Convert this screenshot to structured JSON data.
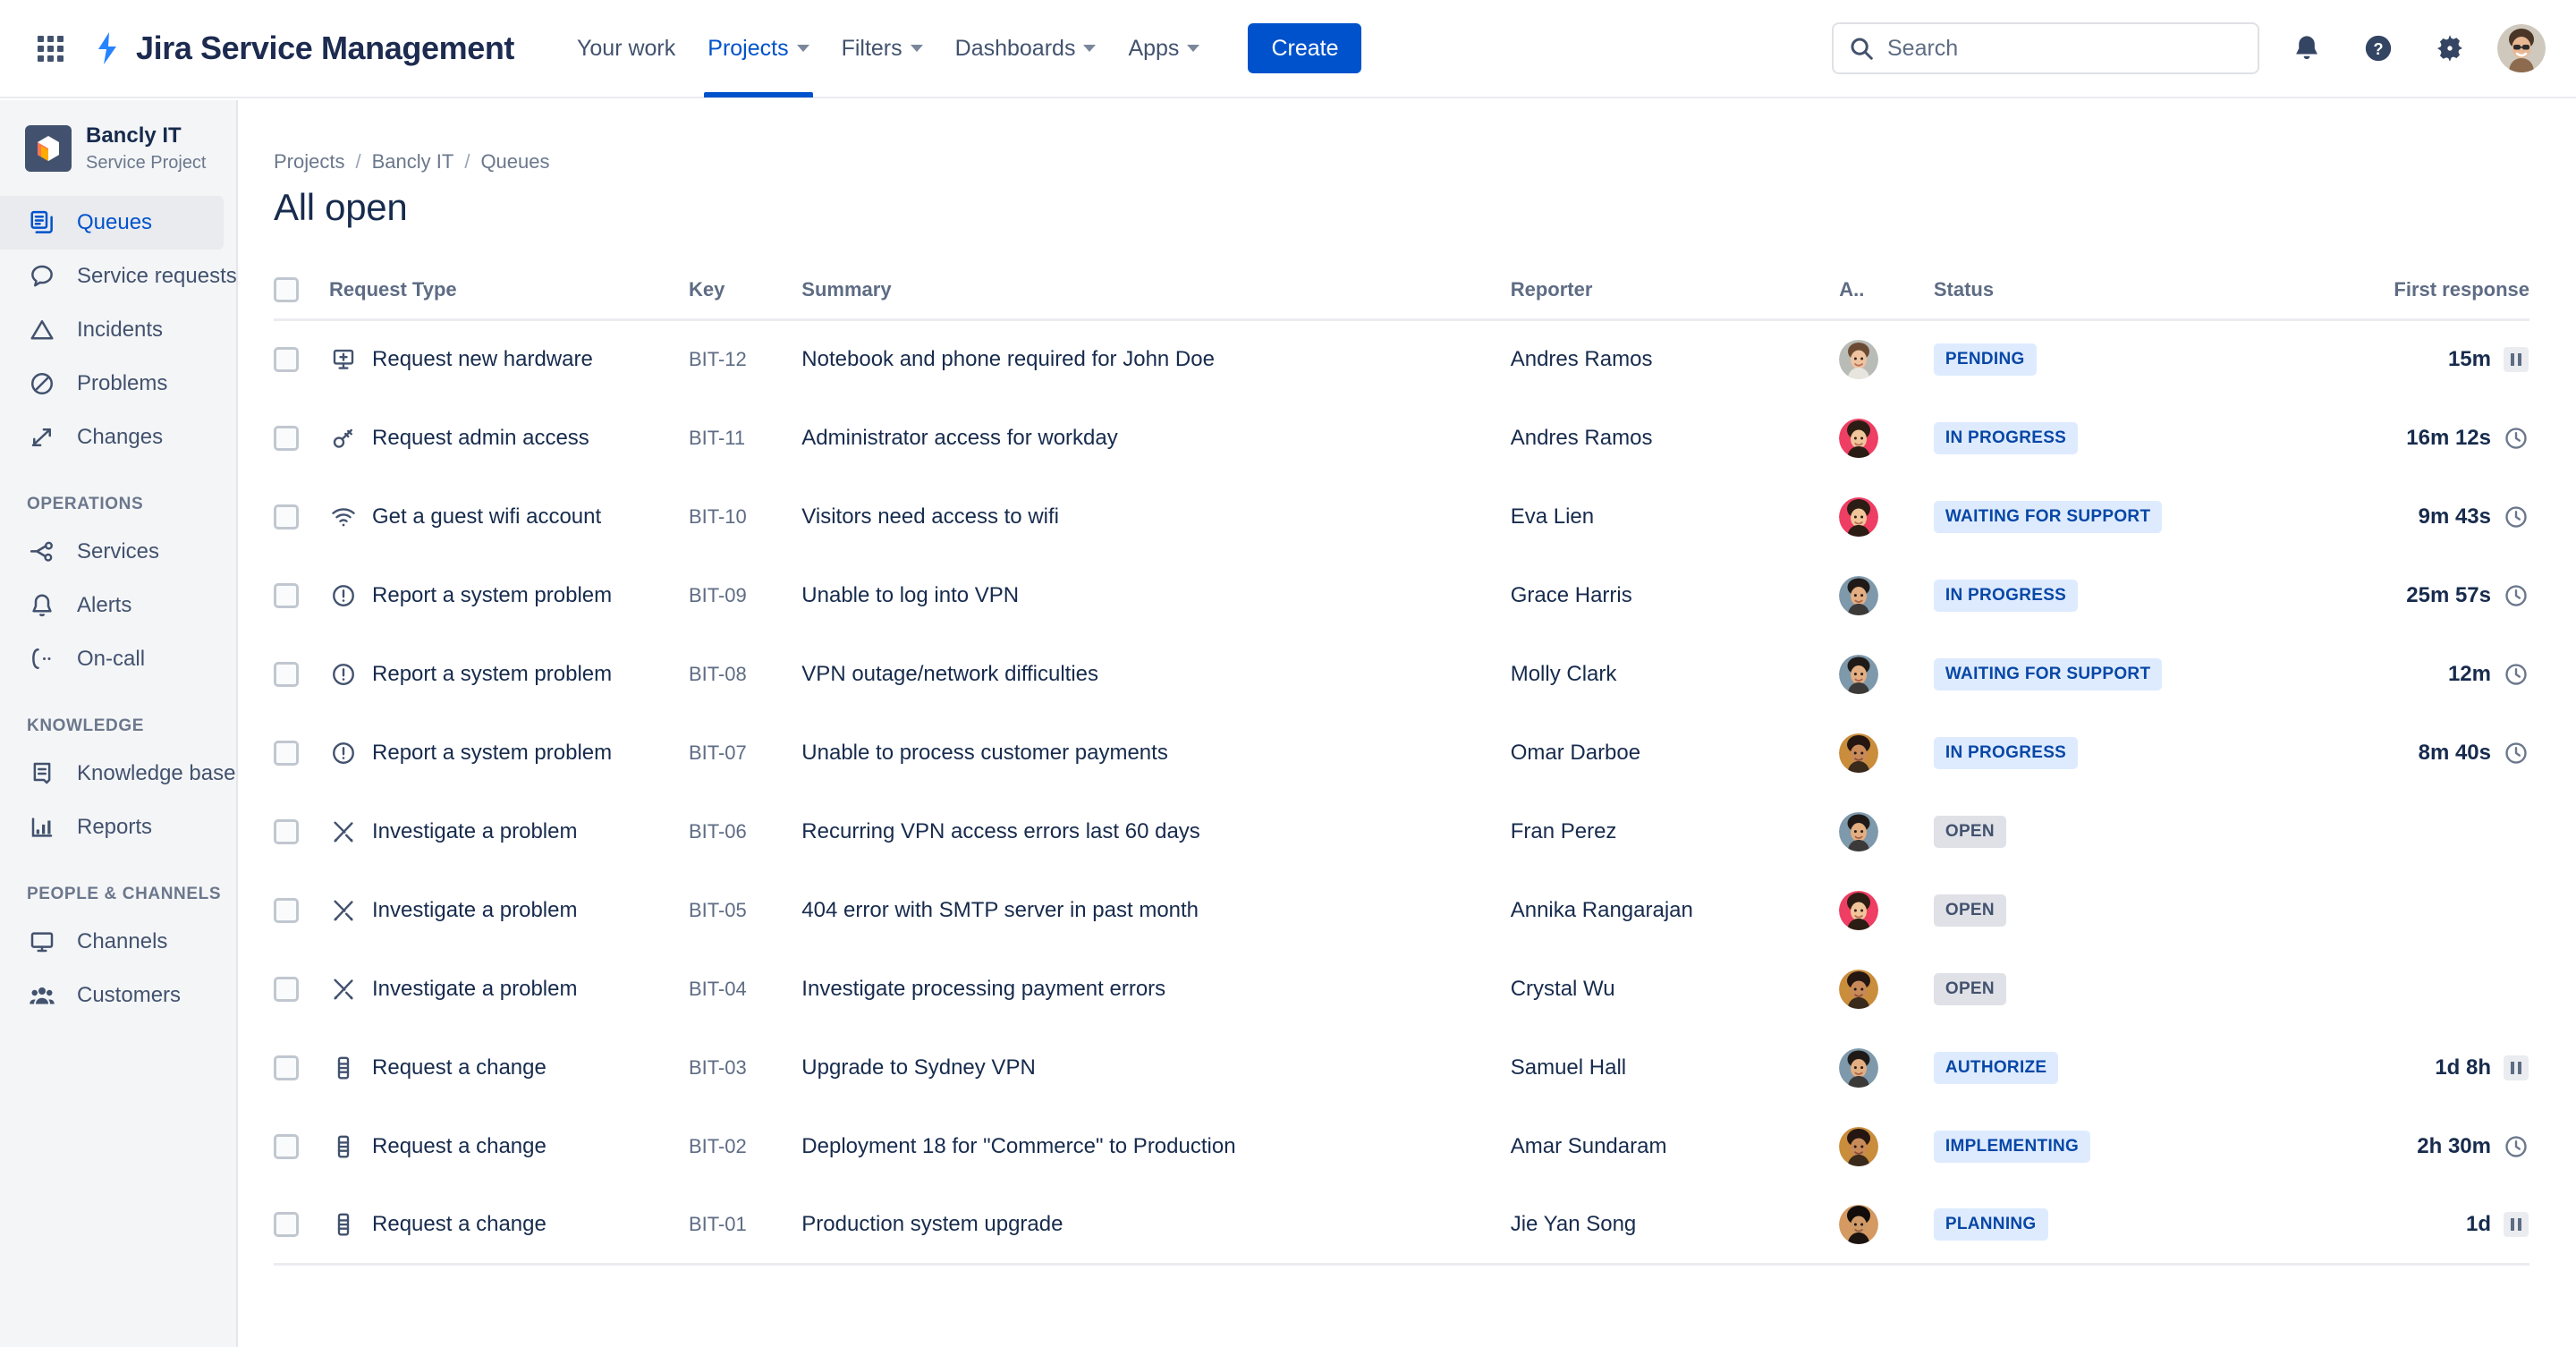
{
  "topnav": {
    "apps_icon": "apps-grid-icon",
    "brand": "Jira Service Management",
    "items": [
      {
        "label": "Your work",
        "has_chevron": false,
        "active": false
      },
      {
        "label": "Projects",
        "has_chevron": true,
        "active": true
      },
      {
        "label": "Filters",
        "has_chevron": true,
        "active": false
      },
      {
        "label": "Dashboards",
        "has_chevron": true,
        "active": false
      },
      {
        "label": "Apps",
        "has_chevron": true,
        "active": false
      }
    ],
    "create_label": "Create",
    "search_placeholder": "Search",
    "search_value": "",
    "icons": [
      "notifications-bell-icon",
      "help-question-icon",
      "settings-gear-icon",
      "user-avatar"
    ]
  },
  "sidebar": {
    "project_name": "Bancly IT",
    "project_type": "Service Project",
    "primary": [
      {
        "label": "Queues",
        "icon": "queues-icon",
        "selected": true
      },
      {
        "label": "Service requests",
        "icon": "speech-bubble-icon",
        "selected": false
      },
      {
        "label": "Incidents",
        "icon": "warning-triangle-icon",
        "selected": false
      },
      {
        "label": "Problems",
        "icon": "no-entry-icon",
        "selected": false
      },
      {
        "label": "Changes",
        "icon": "arrows-swap-icon",
        "selected": false
      }
    ],
    "operations_title": "OPERATIONS",
    "operations": [
      {
        "label": "Services",
        "icon": "services-nodes-icon",
        "selected": false
      },
      {
        "label": "Alerts",
        "icon": "alert-bell-icon",
        "selected": false
      },
      {
        "label": "On-call",
        "icon": "phone-on-call-icon",
        "selected": false
      }
    ],
    "knowledge_title": "KNOWLEDGE",
    "knowledge": [
      {
        "label": "Knowledge base",
        "icon": "book-icon",
        "selected": false
      },
      {
        "label": "Reports",
        "icon": "bar-chart-icon",
        "selected": false
      }
    ],
    "people_title": "PEOPLE & CHANNELS",
    "people": [
      {
        "label": "Channels",
        "icon": "monitor-icon",
        "selected": false
      },
      {
        "label": "Customers",
        "icon": "people-group-icon",
        "selected": false
      }
    ]
  },
  "breadcrumb": {
    "items": [
      "Projects",
      "Bancly IT",
      "Queues"
    ],
    "separator": "/"
  },
  "page_title": "All open",
  "table": {
    "headers": [
      "Request Type",
      "Key",
      "Summary",
      "Reporter",
      "A..",
      "Status",
      "First response"
    ],
    "rows": [
      {
        "type": "Request new hardware",
        "type_icon": "monitor-plus-icon",
        "key": "BIT-12",
        "summary": "Notebook and phone required for John Doe",
        "reporter": "Andres Ramos",
        "status": "PENDING",
        "status_tone": "blue",
        "first_response": "15m",
        "fr_icon": "pause-icon",
        "avatar": "a1"
      },
      {
        "type": "Request admin access",
        "type_icon": "key-icon",
        "key": "BIT-11",
        "summary": "Administrator access for workday",
        "reporter": "Andres Ramos",
        "status": "IN PROGRESS",
        "status_tone": "blue",
        "first_response": "16m 12s",
        "fr_icon": "clock-icon",
        "avatar": "a2"
      },
      {
        "type": "Get a guest wifi account",
        "type_icon": "wifi-icon",
        "key": "BIT-10",
        "summary": "Visitors need access to wifi",
        "reporter": "Eva Lien",
        "status": "WAITING FOR SUPPORT",
        "status_tone": "blue",
        "first_response": "9m 43s",
        "fr_icon": "clock-icon",
        "avatar": "a2"
      },
      {
        "type": "Report a system problem",
        "type_icon": "exclamation-circle-icon",
        "key": "BIT-09",
        "summary": "Unable to log into VPN",
        "reporter": "Grace Harris",
        "status": "IN PROGRESS",
        "status_tone": "blue",
        "first_response": "25m 57s",
        "fr_icon": "clock-icon",
        "avatar": "a3"
      },
      {
        "type": "Report a system problem",
        "type_icon": "exclamation-circle-icon",
        "key": "BIT-08",
        "summary": "VPN outage/network difficulties",
        "reporter": "Molly Clark",
        "status": "WAITING FOR SUPPORT",
        "status_tone": "blue",
        "first_response": "12m",
        "fr_icon": "clock-icon",
        "avatar": "a3"
      },
      {
        "type": "Report a system problem",
        "type_icon": "exclamation-circle-icon",
        "key": "BIT-07",
        "summary": "Unable to process customer payments",
        "reporter": "Omar Darboe",
        "status": "IN PROGRESS",
        "status_tone": "blue",
        "first_response": "8m 40s",
        "fr_icon": "clock-icon",
        "avatar": "a4"
      },
      {
        "type": "Investigate a problem",
        "type_icon": "tools-icon",
        "key": "BIT-06",
        "summary": "Recurring VPN access errors last 60 days",
        "reporter": "Fran Perez",
        "status": "OPEN",
        "status_tone": "grey",
        "first_response": "",
        "fr_icon": "",
        "avatar": "a3"
      },
      {
        "type": "Investigate a problem",
        "type_icon": "tools-icon",
        "key": "BIT-05",
        "summary": "404 error with SMTP server in past month",
        "reporter": "Annika Rangarajan",
        "status": "OPEN",
        "status_tone": "grey",
        "first_response": "",
        "fr_icon": "",
        "avatar": "a2"
      },
      {
        "type": "Investigate a problem",
        "type_icon": "tools-icon",
        "key": "BIT-04",
        "summary": "Investigate processing payment errors",
        "reporter": "Crystal Wu",
        "status": "OPEN",
        "status_tone": "grey",
        "first_response": "",
        "fr_icon": "",
        "avatar": "a4"
      },
      {
        "type": "Request a change",
        "type_icon": "change-doc-icon",
        "key": "BIT-03",
        "summary": "Upgrade to Sydney VPN",
        "reporter": "Samuel Hall",
        "status": "AUTHORIZE",
        "status_tone": "blue",
        "first_response": "1d 8h",
        "fr_icon": "pause-icon",
        "avatar": "a3"
      },
      {
        "type": "Request a change",
        "type_icon": "change-doc-icon",
        "key": "BIT-02",
        "summary": "Deployment 18 for \"Commerce\" to Production",
        "reporter": "Amar Sundaram",
        "status": "IMPLEMENTING",
        "status_tone": "blue",
        "first_response": "2h 30m",
        "fr_icon": "clock-icon",
        "avatar": "a4"
      },
      {
        "type": "Request a change",
        "type_icon": "change-doc-icon",
        "key": "BIT-01",
        "summary": "Production system upgrade",
        "reporter": "Jie Yan Song",
        "status": "PLANNING",
        "status_tone": "blue",
        "first_response": "1d",
        "fr_icon": "pause-icon",
        "avatar": "a5"
      }
    ]
  },
  "colors": {
    "brand_blue": "#0052cc",
    "nav_text": "#42526e",
    "title": "#172b4d",
    "badge_blue_bg": "#deebff",
    "badge_blue_fg": "#0747a6",
    "badge_grey_bg": "#dfe1e6",
    "sidebar_bg": "#f4f5f7"
  }
}
